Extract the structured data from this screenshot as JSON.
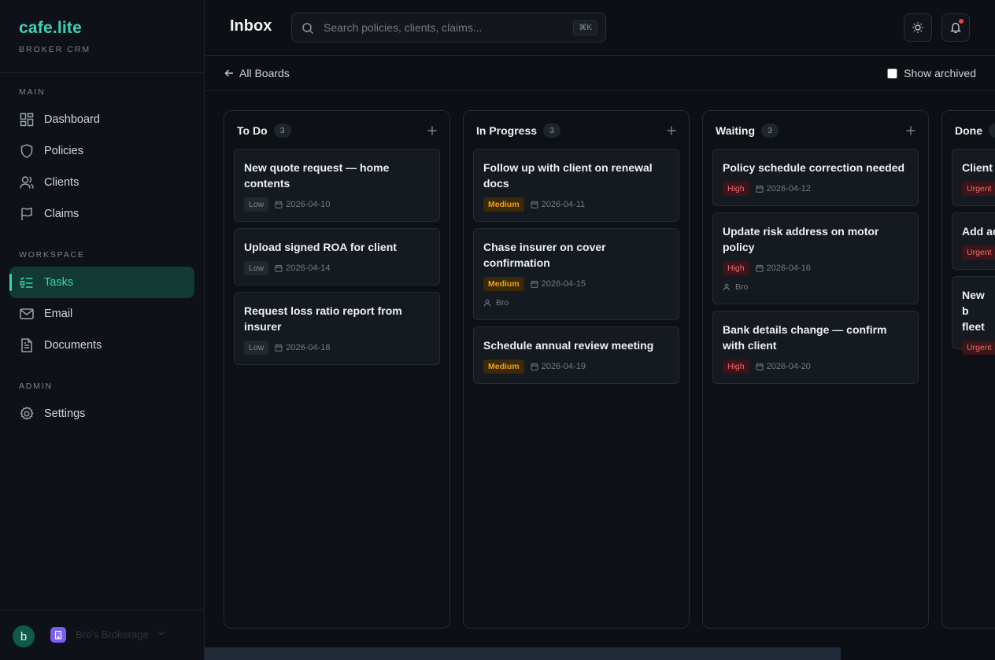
{
  "brand": {
    "name": "cafe.lite",
    "subtitle": "BROKER CRM"
  },
  "sidebar": {
    "sections": [
      {
        "label": "MAIN"
      },
      {
        "label": "WORKSPACE"
      },
      {
        "label": "ADMIN"
      }
    ],
    "items": [
      {
        "label": "Dashboard",
        "icon": "dashboard-icon"
      },
      {
        "label": "Policies",
        "icon": "shield-icon"
      },
      {
        "label": "Clients",
        "icon": "users-icon"
      },
      {
        "label": "Claims",
        "icon": "flag-icon"
      },
      {
        "label": "Tasks",
        "icon": "tasks-icon",
        "active": true
      },
      {
        "label": "Email",
        "icon": "mail-icon"
      },
      {
        "label": "Documents",
        "icon": "document-icon"
      },
      {
        "label": "Settings",
        "icon": "gear-icon"
      }
    ],
    "user": {
      "initial": "b",
      "org_name": "Bro's Brokerage"
    }
  },
  "header": {
    "title": "Inbox",
    "search": {
      "placeholder": "Search policies, clients, claims...",
      "shortcut": "⌘K"
    }
  },
  "toolbar": {
    "back_label": "All Boards",
    "show_archived_label": "Show archived",
    "show_archived": false
  },
  "colors": {
    "accent": "#3fd3b6",
    "priority_low": "#7f8792",
    "priority_medium": "#f0a21b",
    "priority_high": "#f06b6b",
    "priority_urgent": "#f06b6b"
  },
  "columns": [
    {
      "title": "To Do",
      "count": "3",
      "cards": [
        {
          "title": "New quote request — home contents",
          "priority": "Low",
          "date": "2026-04-10"
        },
        {
          "title": "Upload signed ROA for client",
          "priority": "Low",
          "date": "2026-04-14"
        },
        {
          "title": "Request loss ratio report from insurer",
          "priority": "Low",
          "date": "2026-04-18"
        }
      ]
    },
    {
      "title": "In Progress",
      "count": "3",
      "cards": [
        {
          "title": "Follow up with client on renewal docs",
          "priority": "Medium",
          "date": "2026-04-11"
        },
        {
          "title": "Chase insurer on cover confirmation",
          "priority": "Medium",
          "date": "2026-04-15",
          "assignee": "Bro"
        },
        {
          "title": "Schedule annual review meeting",
          "priority": "Medium",
          "date": "2026-04-19"
        }
      ]
    },
    {
      "title": "Waiting",
      "count": "3",
      "cards": [
        {
          "title": "Policy schedule correction needed",
          "priority": "High",
          "date": "2026-04-12"
        },
        {
          "title": "Update risk address on motor policy",
          "priority": "High",
          "date": "2026-04-16",
          "assignee": "Bro"
        },
        {
          "title": "Bank details change — confirm with client",
          "priority": "High",
          "date": "2026-04-20"
        }
      ]
    },
    {
      "title": "Done",
      "count": "",
      "cards": [
        {
          "title": "Client",
          "priority": "Urgent"
        },
        {
          "title": "Add ac",
          "priority": "Urgent"
        },
        {
          "title": "New b fleet",
          "priority": "Urgent"
        }
      ]
    }
  ]
}
